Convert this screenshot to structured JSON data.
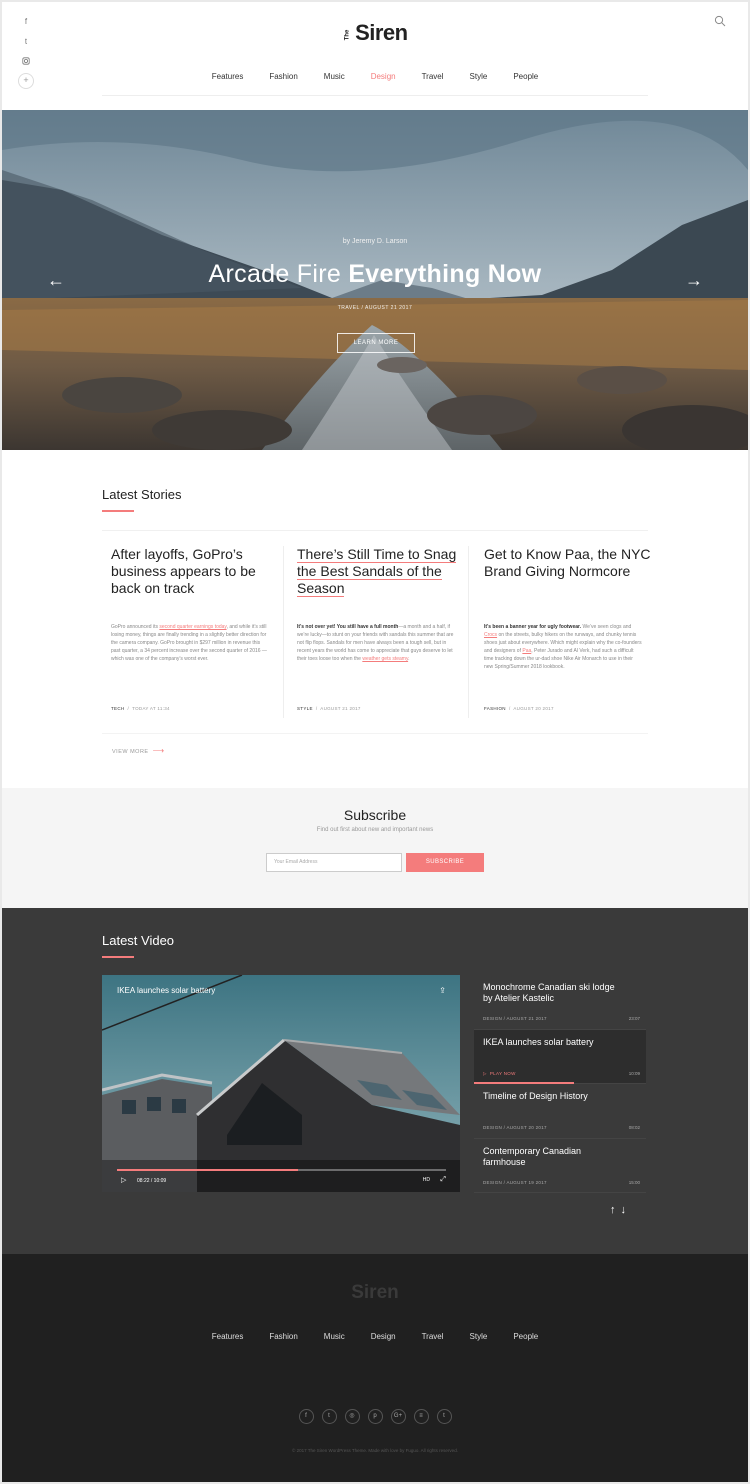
{
  "header": {
    "logo_small": "The",
    "logo_name": "Siren",
    "social": [
      "f",
      "t",
      "ig",
      "+"
    ],
    "nav": [
      "Features",
      "Fashion",
      "Music",
      "Design",
      "Travel",
      "Style",
      "People"
    ],
    "active_nav": "Design"
  },
  "hero": {
    "byline": "by Jeremy D. Larson",
    "title_light": "Arcade Fire ",
    "title_bold": "Everything Now",
    "meta": "TRAVEL  /  AUGUST 21 2017",
    "button": "LEARN MORE",
    "prev": "←",
    "next": "→"
  },
  "latest_stories": {
    "title": "Latest Stories",
    "cards": [
      {
        "title": "After layoffs, GoPro’s business appears to be back on track",
        "body_pre": "GoPro announced its ",
        "body_link": "second quarter earnings today",
        "body_post": ", and while it’s still losing money, things are finally trending in a slightly better direction for the camera company. GoPro brought in $297 million in revenue this past quarter, a 34 percent increase over the second quarter of 2016 — which was one of the company’s worst ever.",
        "category": "TECH",
        "date": "TODAY AT 11:34"
      },
      {
        "title": "There’s Still Time to Snag the Best Sandals of the Season",
        "body_bold": "It’s not over yet! You still have a full month",
        "body_pre": "—a month and a half, if we’re lucky—to stunt on your friends with sandals this summer that are not flip flops. Sandals for men have always been a tough sell, but in recent years the world has come to appreciate that guys deserve to let their toes loose too when the ",
        "body_link": "weather gets steamy",
        "body_post": ".",
        "category": "STYLE",
        "date": "AUGUST 21 2017"
      },
      {
        "title": "Get to Know Paa, the NYC Brand Giving Normcore",
        "body_bold": "It’s been a banner year for ugly footwear.",
        "body_pre": " We’ve seen clogs and ",
        "body_link": "Crocs",
        "body_mid": " on the streets, bulky hikers on the runways, and chunky tennis shoes just about everywhere. Which might explain why the co-founders and designers of ",
        "body_link2": "Paa",
        "body_post": ", Peter Jurado and Al Verk, had such a difficult time tracking down the ur-dad shoe Nike Air Monarch to use in their new Spring/Summer 2018 lookbook.",
        "category": "FASHION",
        "date": "AUGUST 20 2017"
      }
    ],
    "view_more": "VIEW MORE"
  },
  "subscribe": {
    "title": "Subscribe",
    "subtitle": "Find out first about new and important news",
    "placeholder": "Your Email Address",
    "button": "SUBSCRIBE"
  },
  "latest_video": {
    "title": "Latest Video",
    "player": {
      "title": "IKEA launches solar battery",
      "time": "08:22 / 10:09",
      "progress": 0.55,
      "hd": "HD"
    },
    "playlist": [
      {
        "title": "Monochrome Canadian ski lodge by Atelier Kastelic",
        "meta": "DESIGN  /  AUGUST 21 2017",
        "duration": "23:07",
        "active": false
      },
      {
        "title": "IKEA launches solar battery",
        "meta": "PLAY NOW",
        "duration": "10:09",
        "active": true
      },
      {
        "title": "Timeline of Design History",
        "meta": "DESIGN  /  AUGUST 20 2017",
        "duration": "08:02",
        "active": false
      },
      {
        "title": "Contemporary Canadian farmhouse",
        "meta": "DESIGN  /  AUGUST 19 2017",
        "duration": "15:00",
        "active": false
      }
    ]
  },
  "footer": {
    "logo": "Siren",
    "nav": [
      "Features",
      "Fashion",
      "Music",
      "Design",
      "Travel",
      "Style",
      "People"
    ],
    "social": [
      "f",
      "t",
      "◎",
      "p",
      "G+",
      "≡",
      "t"
    ],
    "copyright": "© 2017 The Siren WordPress Theme. Made with love by Fuguo. All rights reserved."
  },
  "colors": {
    "accent": "#f47c7c",
    "dark": "#3a3a3a",
    "footer": "#202020"
  }
}
